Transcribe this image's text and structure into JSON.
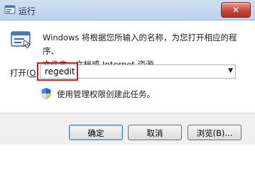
{
  "window": {
    "title": "运行",
    "close_label": "✕"
  },
  "main": {
    "description_line1": "Windows 将根据您所输入的名称，为您打开相应的程序、",
    "description_line2": "文件夹、文档或 Internet 资源。",
    "open_label": "打开",
    "open_label_prefix": "(",
    "open_label_key": "O",
    "open_label_suffix": "):",
    "input_value": "regedit",
    "admin_note": "使用管理权限创建此任务。"
  },
  "buttons": {
    "ok": "确定",
    "cancel": "取消",
    "browse": "浏览(B)..."
  },
  "icons": {
    "run": "run-program-icon",
    "shield": "uac-shield-icon",
    "dropdown": "chevron-down-icon"
  },
  "colors": {
    "highlight": "#d01818",
    "close": "#c6473a"
  }
}
